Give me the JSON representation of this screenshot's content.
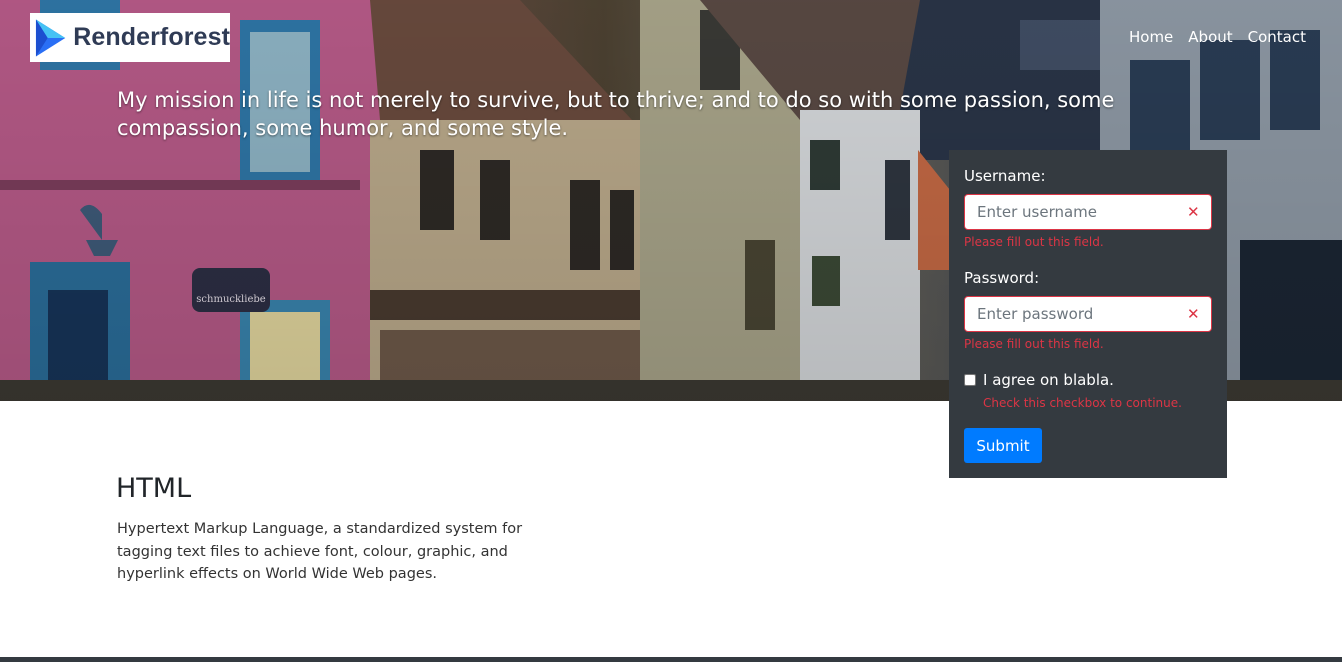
{
  "brand": {
    "name": "Renderforest"
  },
  "nav": {
    "items": [
      "Home",
      "About",
      "Contact"
    ]
  },
  "hero": {
    "quote": "My mission in life is not merely to survive, but to thrive; and to do so with some passion, some compassion, some humor, and some style.",
    "sign_text": "schmuckliebe"
  },
  "form": {
    "username_label": "Username:",
    "username_placeholder": "Enter username",
    "username_error": "Please fill out this field.",
    "password_label": "Password:",
    "password_placeholder": "Enter password",
    "password_error": "Please fill out this field.",
    "agree_label": "I agree on blabla.",
    "agree_error": "Check this checkbox to continue.",
    "submit_label": "Submit",
    "clear_glyph": "✕"
  },
  "content": {
    "title": "HTML",
    "description": "Hypertext Markup Language, a standardized system for tagging text files to achieve font, colour, graphic, and hyperlink effects on World Wide Web pages."
  },
  "colors": {
    "panel": "#343a40",
    "error": "#dc3545",
    "primary": "#007bff",
    "brand_text": "#2f3b55"
  }
}
